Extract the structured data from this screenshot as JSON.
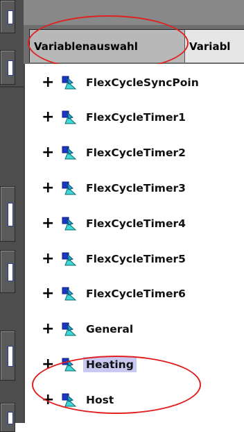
{
  "tabs": [
    {
      "label": "Variablenauswahl",
      "active": true
    },
    {
      "label": "Variabl",
      "active": false
    }
  ],
  "tree": {
    "items": [
      {
        "label": "FlexCycleSyncPoin",
        "expander": "+"
      },
      {
        "label": "FlexCycleTimer1",
        "expander": "+"
      },
      {
        "label": "FlexCycleTimer2",
        "expander": "+"
      },
      {
        "label": "FlexCycleTimer3",
        "expander": "+"
      },
      {
        "label": "FlexCycleTimer4",
        "expander": "+"
      },
      {
        "label": "FlexCycleTimer5",
        "expander": "+"
      },
      {
        "label": "FlexCycleTimer6",
        "expander": "+"
      },
      {
        "label": "General",
        "expander": "+"
      },
      {
        "label": "Heating",
        "expander": "+",
        "selected": true
      },
      {
        "label": "Host",
        "expander": "+"
      }
    ]
  },
  "colors": {
    "annotation": "#e02020",
    "selection": "#c8c8f0",
    "toolbar": "#4d4d4d"
  },
  "icons": {
    "tree_node": "variable-group-icon"
  }
}
